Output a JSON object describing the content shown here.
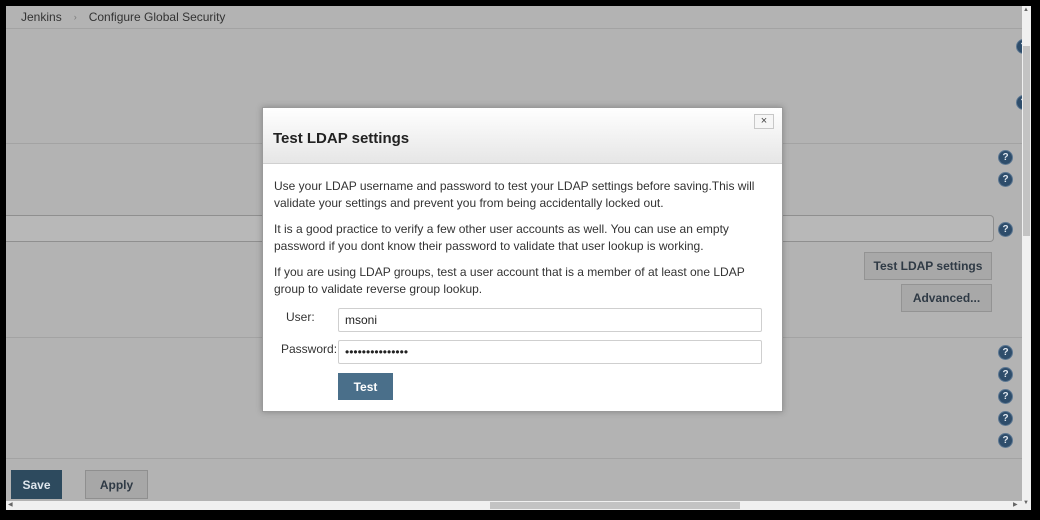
{
  "breadcrumb": {
    "items": [
      "Jenkins",
      "Configure Global Security"
    ],
    "separator": "›"
  },
  "background": {
    "test_ldap_button": "Test LDAP settings",
    "advanced_button": "Advanced...",
    "save_button": "Save",
    "apply_button": "Apply",
    "help_icon_glyph": "?"
  },
  "dialog": {
    "title": "Test LDAP settings",
    "close_glyph": "×",
    "paragraphs": [
      "Use your LDAP username and password to test your LDAP settings before saving.This will validate your settings and prevent you from being accidentally locked out.",
      "It is a good practice to verify a few other user accounts as well. You can use an empty password if you dont know their password to validate that user lookup is working.",
      "If you are using LDAP groups, test a user account that is a member of at least one LDAP group to validate reverse group lookup."
    ],
    "user_label": "User:",
    "user_value": "msoni",
    "password_label": "Password:",
    "password_value": "***************",
    "test_button": "Test"
  },
  "colors": {
    "overlay_background": "#b3b3b3",
    "primary_button": "#2d4a5e",
    "test_button": "#4a6f8a",
    "help_icon": "#2e4d6b"
  }
}
